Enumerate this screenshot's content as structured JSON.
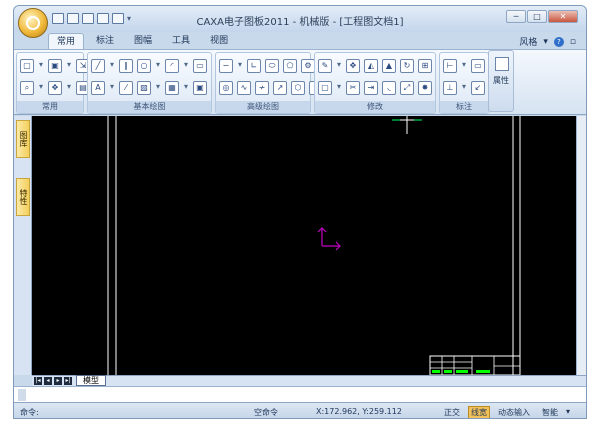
{
  "window": {
    "title": "CAXA电子图板2011 - 机械版 - [工程图文档1]",
    "minimize": "─",
    "maximize": "□",
    "close": "✕"
  },
  "quick_access": [
    "new",
    "open",
    "save",
    "undo",
    "redo"
  ],
  "ribbon_tabs": [
    "常用",
    "标注",
    "图幅",
    "工具",
    "视图"
  ],
  "style_label": "风格",
  "help": "?",
  "ribbon_groups": {
    "common": "常用",
    "basic_draw": "基本绘图",
    "advanced_draw": "高级绘图",
    "modify": "修改",
    "annotate": "标注"
  },
  "properties_label": "属性",
  "side_tabs": [
    "图库",
    "特性"
  ],
  "sheet_tab": "模型",
  "sheet_nav": [
    "|◂",
    "◂",
    "▸",
    "▸|"
  ],
  "status": {
    "command_label": "命令:",
    "empty_command": "空命令",
    "coords": "X:172.962, Y:259.112",
    "ortho": "正交",
    "line_width": "线宽",
    "dynamic_input": "动态输入",
    "smart": "智能"
  },
  "colors": {
    "canvas": "#000000",
    "ucs": "#c000c0",
    "border_lines": "#ffffff",
    "title_block_text": "#00ff00",
    "crosshair": "#00ff66"
  }
}
